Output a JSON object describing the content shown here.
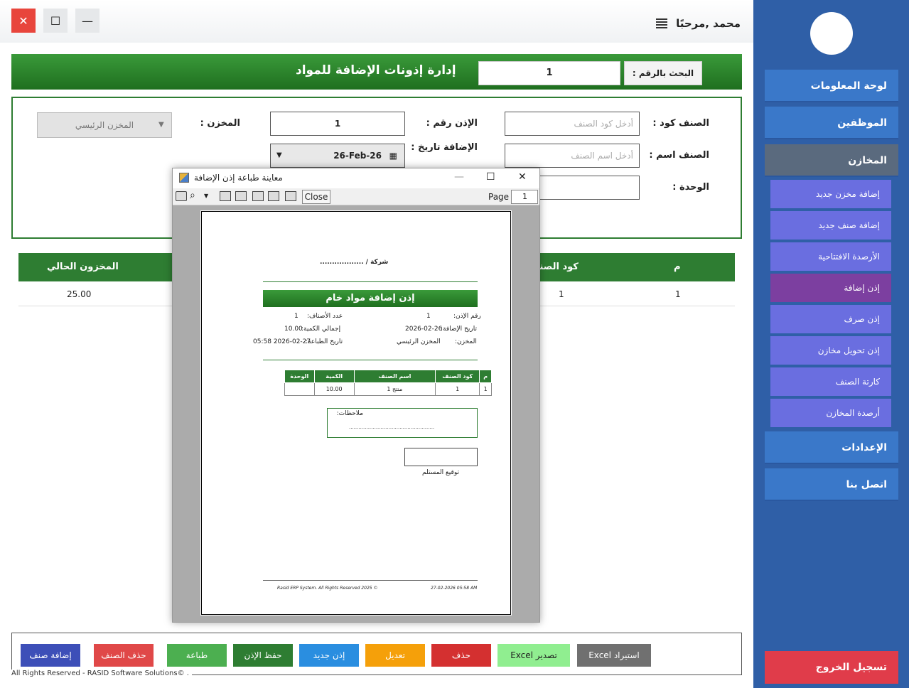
{
  "window": {
    "close_label": "✕",
    "max_label": "☐",
    "min_label": "—"
  },
  "header": {
    "greeting": "محمد ,مرحبًا"
  },
  "titlebar": {
    "title": "إدارة إذونات الإضافة للمواد",
    "search_label": "البحث بالرقم :",
    "search_value": "1"
  },
  "form": {
    "item_code_label": "الصنف كود :",
    "item_code_placeholder": "أدخل كود الصنف",
    "item_name_label": "الصنف اسم :",
    "item_name_placeholder": "أدخل اسم الصنف",
    "unit_label": "الوحدة :",
    "permit_no_label": "الإذن رقم :",
    "permit_no_value": "1",
    "add_date_label": "الإضافة تاريخ :",
    "add_date_value": "26-Feb-26",
    "warehouse_label": "المخزن :",
    "warehouse_value": "المخزن الرئيسي"
  },
  "grid": {
    "headers": {
      "index": "م",
      "item_code": "كود الصنف",
      "stock": "المخزون الحالي"
    },
    "rows": [
      {
        "index": "1",
        "item_code": "1",
        "stock": "25.00"
      }
    ]
  },
  "actions": [
    {
      "label": "إضافة صنف",
      "color": "#3d4fb8"
    },
    {
      "label": "حذف الصنف",
      "color": "#e04848"
    },
    {
      "label": "طباعة",
      "color": "#4caf50"
    },
    {
      "label": "حفظ الإذن",
      "color": "#2e7d32"
    },
    {
      "label": "إذن جديد",
      "color": "#2a8ee0"
    },
    {
      "label": "تعديل",
      "color": "#f5a00a"
    },
    {
      "label": "حذف",
      "color": "#d43030"
    },
    {
      "label": "تصدير Excel",
      "color": "#90ee90"
    },
    {
      "label": "استيراد Excel",
      "color": "#707070"
    }
  ],
  "footer": "All Rights Reserved - RASID Software Solutions© .",
  "sidebar": {
    "items": [
      {
        "label": "لوحة المعلومات"
      },
      {
        "label": "الموظفين"
      },
      {
        "label": "المخازن"
      }
    ],
    "subitems": [
      {
        "label": "إضافة مخزن جديد"
      },
      {
        "label": "إضافة صنف جديد"
      },
      {
        "label": "الأرصدة الافتتاحية"
      },
      {
        "label": "إذن إضافة"
      },
      {
        "label": "إذن صرف"
      },
      {
        "label": "إذن تحويل مخازن"
      },
      {
        "label": "كارتة الصنف"
      },
      {
        "label": "أرصدة المخازن"
      }
    ],
    "bottom_items": [
      {
        "label": "الإعدادات"
      },
      {
        "label": "اتصل بنا"
      }
    ],
    "logout": "تسجيل الخروج"
  },
  "preview": {
    "title": "معاينة طباعة إذن الإضافة",
    "close_label": "Close",
    "page_label": "Page",
    "page_value": "1",
    "doc": {
      "company": "شركة / ..................",
      "title": "إذن إضافة مواد خام",
      "permit_no_label": "رقم الإذن:",
      "permit_no": "1",
      "add_date_label": "تاريخ الإضافة:",
      "add_date": "2026-02-26",
      "warehouse_label": "المخزن:",
      "warehouse": "المخزن الرئيسي",
      "count_label": "عدد الأصناف:",
      "count": "1",
      "total_label": "إجمالي الكمية:",
      "total": "10.00",
      "print_date_label": "تاريخ الطباعة:",
      "print_date": "2026-02-27 05:58",
      "table_headers": [
        "م",
        "كود الصنف",
        "اسم الصنف",
        "الكمية",
        "الوحدة"
      ],
      "table_row": [
        "1",
        "1",
        "منتج 1",
        "10.00",
        ""
      ],
      "notes_label": "ملاحظات:",
      "notes_line": "......................................................",
      "signature_label": "توقيع المستلم",
      "footer_left": "Rasid ERP System. All Rights Reserved 2025 ©",
      "footer_right": "27-02-2026 05:58 AM"
    }
  }
}
